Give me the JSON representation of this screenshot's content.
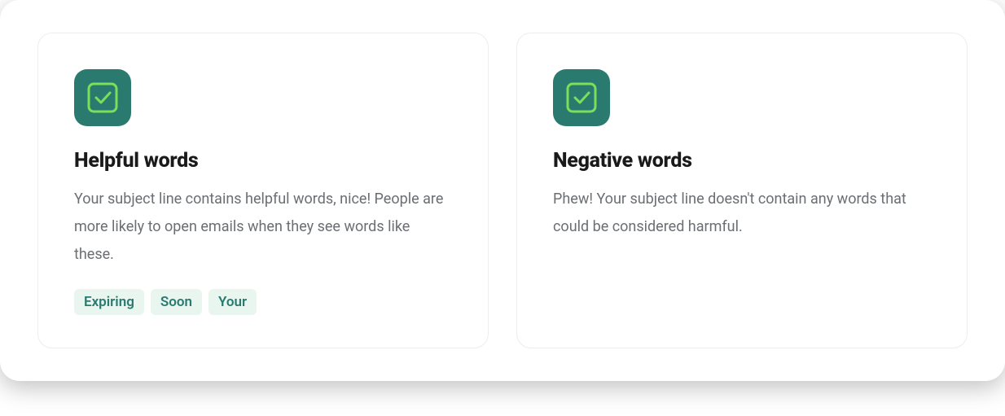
{
  "cards": {
    "helpful": {
      "title": "Helpful words",
      "description": "Your subject line contains helpful words, nice! People are more likely to open emails when they see words like these.",
      "tags": [
        "Expiring",
        "Soon",
        "Your"
      ],
      "icon": "check-square-icon"
    },
    "negative": {
      "title": "Negative words",
      "description": "Phew! Your subject line doesn't contain any words that could be considered harmful.",
      "tags": [],
      "icon": "check-square-icon"
    }
  },
  "colors": {
    "iconBg": "#2a7a6f",
    "iconStroke": "#78e059",
    "tagBg": "#e9f6f0",
    "tagText": "#2a7a6f"
  }
}
